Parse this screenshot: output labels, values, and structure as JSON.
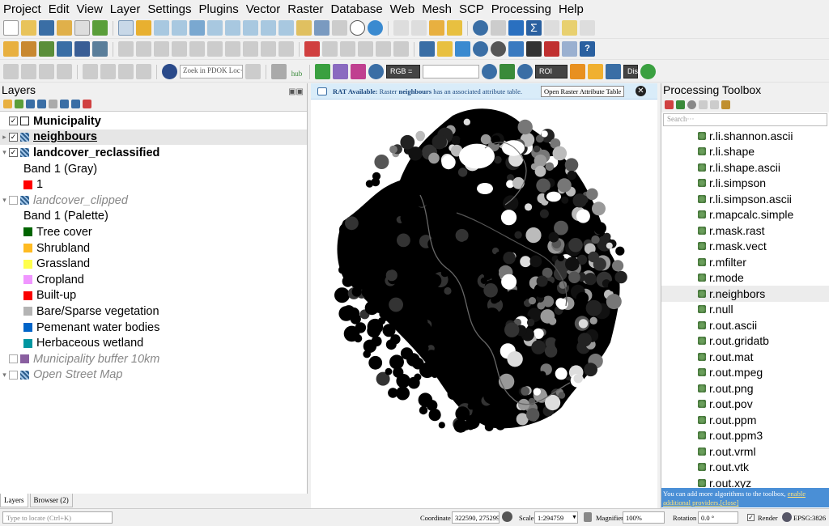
{
  "menu": [
    "Project",
    "Edit",
    "View",
    "Layer",
    "Settings",
    "Plugins",
    "Vector",
    "Raster",
    "Database",
    "Web",
    "Mesh",
    "SCP",
    "Processing",
    "Help"
  ],
  "toolbar": {
    "locator_text": "Zoek in PDOK Loc···",
    "hub_label": "hub",
    "rgb_combo": "RGB =",
    "roi_combo": "ROI",
    "dist_label": "Dist"
  },
  "layers_panel": {
    "title": "Layers",
    "items": [
      {
        "label": "Municipality",
        "checked": true
      },
      {
        "label": "neighbours",
        "checked": true
      },
      {
        "label": "landcover_reclassified",
        "checked": true
      },
      {
        "label": "Band 1 (Gray)"
      },
      {
        "label": "1",
        "color": "#ff0000"
      },
      {
        "label": "landcover_clipped",
        "checked": false
      },
      {
        "label": "Band 1 (Palette)"
      },
      {
        "label": "Tree cover",
        "color": "#006400"
      },
      {
        "label": "Shrubland",
        "color": "#ffbb22"
      },
      {
        "label": "Grassland",
        "color": "#ffff4c"
      },
      {
        "label": "Cropland",
        "color": "#f096ff"
      },
      {
        "label": "Built-up",
        "color": "#fa0000"
      },
      {
        "label": "Bare/Sparse vegetation",
        "color": "#b4b4b4"
      },
      {
        "label": "Pemenant water bodies",
        "color": "#0064c8"
      },
      {
        "label": "Herbaceous wetland",
        "color": "#0096a0"
      },
      {
        "label": "Municipality buffer 10km",
        "checked": false,
        "color": "#8a5fa0"
      },
      {
        "label": "Open Street Map",
        "checked": false
      }
    ],
    "tabs": [
      "Layers",
      "Browser (2)"
    ]
  },
  "rat_bar": {
    "prefix": "RAT Available:",
    "middle": " Raster ",
    "layer": "neighbours",
    "suffix": " has an associated attribute table.",
    "button": "Open Raster Attribute Table",
    "close": "✕"
  },
  "processing": {
    "title": "Processing Toolbox",
    "search_placeholder": "Search···",
    "algorithms": [
      "r.li.shannon.ascii",
      "r.li.shape",
      "r.li.shape.ascii",
      "r.li.simpson",
      "r.li.simpson.ascii",
      "r.mapcalc.simple",
      "r.mask.rast",
      "r.mask.vect",
      "r.mfilter",
      "r.mode",
      "r.neighbors",
      "r.null",
      "r.out.ascii",
      "r.out.gridatb",
      "r.out.mat",
      "r.out.mpeg",
      "r.out.png",
      "r.out.pov",
      "r.out.ppm",
      "r.out.ppm3",
      "r.out.vrml",
      "r.out.vtk",
      "r.out.xyz"
    ],
    "selected": "r.neighbors",
    "note_prefix": "You can add more algorithms to the toolbox, ",
    "note_link": "enable additional providers.",
    "note_close": "[close]"
  },
  "statusbar": {
    "locate_placeholder": "Type to locate (Ctrl+K)",
    "coordinate_label": "Coordinate",
    "coordinate_value": "322590, 2752998",
    "scale_label": "Scale",
    "scale_value": "1:294759",
    "magnifier_label": "Magnifier",
    "magnifier_value": "100%",
    "rotation_label": "Rotation",
    "rotation_value": "0.0 °",
    "render_label": "Render",
    "crs": "EPSG:3826"
  }
}
